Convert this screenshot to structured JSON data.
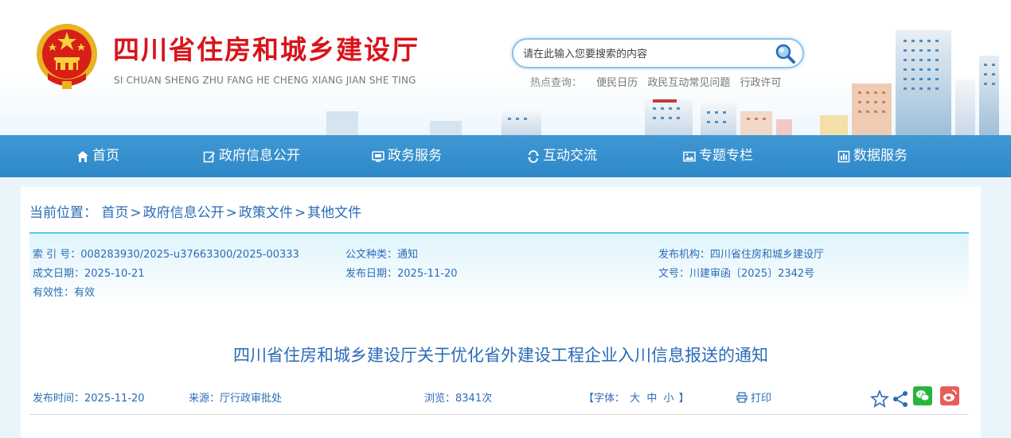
{
  "header": {
    "title": "四川省住房和城乡建设厅",
    "subtitle": "SI CHUAN SHENG ZHU FANG HE CHENG XIANG JIAN SHE TING",
    "search_placeholder": "请在此输入您要搜索的内容",
    "hot_label": "热点查询：",
    "hot_links": [
      "便民日历",
      "政民互动常见问题",
      "行政许可"
    ]
  },
  "nav": {
    "items": [
      {
        "label": "首页",
        "icon": "home-icon"
      },
      {
        "label": "政府信息公开",
        "icon": "edit-icon"
      },
      {
        "label": "政务服务",
        "icon": "monitor-icon"
      },
      {
        "label": "互动交流",
        "icon": "interaction-icon"
      },
      {
        "label": "专题专栏",
        "icon": "image-icon"
      },
      {
        "label": "数据服务",
        "icon": "bar-chart-icon"
      }
    ]
  },
  "breadcrumb": {
    "label": "当前位置：",
    "items": [
      "首页",
      "政府信息公开",
      "政策文件",
      "其他文件"
    ],
    "separator": ">"
  },
  "meta": {
    "index_no": "索 引 号：008283930/2025-u37663300/2025-00333",
    "doc_type": "公文种类：通知",
    "publisher": "发布机构：四川省住房和城乡建设厅",
    "created": "成文日期：2025-10-21",
    "published": "发布日期：2025-11-20",
    "doc_no": "文号：川建审函〔2025〕2342号",
    "validity": "有效性：有效"
  },
  "article": {
    "title": "四川省住房和城乡建设厅关于优化省外建设工程企业入川信息报送的通知",
    "publish_time": "发布时间：2025-11-20",
    "source": "来源：厅行政审批处",
    "views": "浏览：8341次",
    "font_label_open": "【字体：",
    "font_sizes": [
      "大",
      "中",
      "小"
    ],
    "font_label_close": "】",
    "print_label": "打印"
  },
  "colors": {
    "title_red": "#d8141b",
    "nav_blue": "#3a93d0",
    "text_blue": "#2a6bb8",
    "meta_border": "#5cc5ec",
    "wechat_green": "#27b540",
    "weibo_red": "#e85c5a"
  }
}
